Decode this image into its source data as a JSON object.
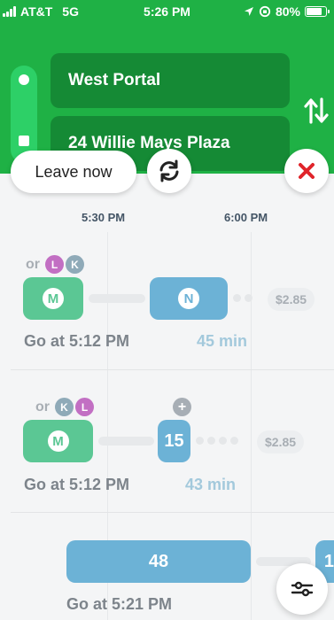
{
  "status_bar": {
    "carrier": "AT&T",
    "network": "5G",
    "time": "5:26 PM",
    "battery": "80%",
    "battery_level": 0.8
  },
  "trip": {
    "origin": "West Portal",
    "destination": "24 Willie Mays Plaza"
  },
  "controls": {
    "leave_label": "Leave now"
  },
  "timeline": {
    "ticks": [
      "5:30 PM",
      "6:00 PM"
    ]
  },
  "routes": [
    {
      "or_label": "or",
      "alt_lines": [
        "L",
        "K"
      ],
      "segments": [
        "M",
        "N"
      ],
      "fare": "$2.85",
      "go": "Go at 5:12 PM",
      "duration": "45 min"
    },
    {
      "or_label": "or",
      "alt_lines": [
        "K",
        "L"
      ],
      "plus_badge": "+",
      "segments": [
        "M",
        "15"
      ],
      "fare": "$2.85",
      "go": "Go at 5:12 PM",
      "duration": "43 min"
    },
    {
      "segments": [
        "48",
        "1"
      ],
      "go": "Go at 5:21 PM"
    }
  ],
  "colors": {
    "header": "#1fb145",
    "muni_metro": "#5bc794",
    "bus": "#6cb2d6",
    "close": "#e0242a"
  }
}
